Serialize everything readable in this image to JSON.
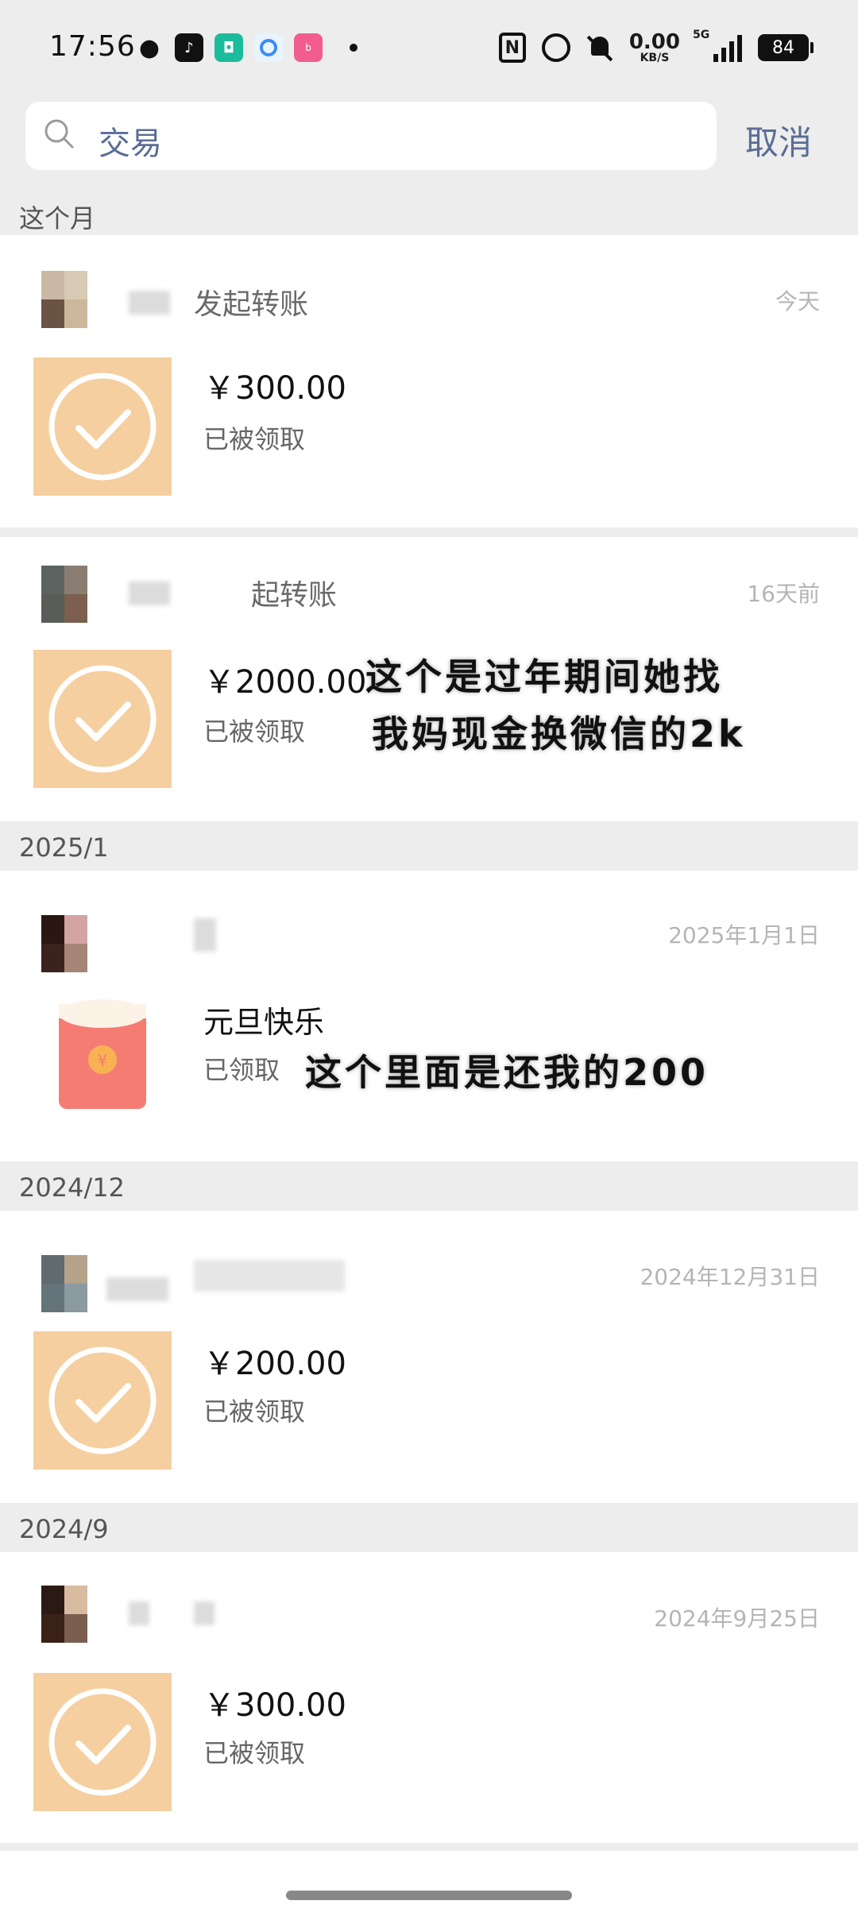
{
  "status_bar": {
    "time": "17:56",
    "app_icons": [
      "wechat-icon",
      "tiktok-icon",
      "mi-home-icon",
      "qq-browser-icon",
      "bilibili-icon"
    ],
    "net_speed": "0.00",
    "net_unit": "KB/S",
    "network": "5G",
    "battery": "84"
  },
  "search": {
    "query": "交易",
    "cancel_label": "取消"
  },
  "sections": [
    {
      "label": "这个月"
    },
    {
      "label": "2025/1"
    },
    {
      "label": "2024/12"
    },
    {
      "label": "2024/9"
    }
  ],
  "records": [
    {
      "title": "发起转账",
      "date": "今天",
      "amount": "￥300.00",
      "status": "已被领取"
    },
    {
      "title": "起转账",
      "date": "16天前",
      "amount": "￥2000.00",
      "status": "已被领取",
      "note_line1": "这个是过年期间她找",
      "note_line2": "我妈现金换微信的2k"
    },
    {
      "title": "",
      "date": "2025年1月1日",
      "amount": "元旦快乐",
      "status": "已领取",
      "note_line1": "这个里面是还我的200"
    },
    {
      "title": "",
      "date": "2024年12月31日",
      "amount": "￥200.00",
      "status": "已被领取"
    },
    {
      "title": "",
      "date": "2024年9月25日",
      "amount": "￥300.00",
      "status": "已被领取"
    }
  ],
  "colors": {
    "background": "#ededed",
    "transfer_tile": "#f5cf9f",
    "red_packet": "#f57c73",
    "link_blue": "#5a6d95"
  }
}
